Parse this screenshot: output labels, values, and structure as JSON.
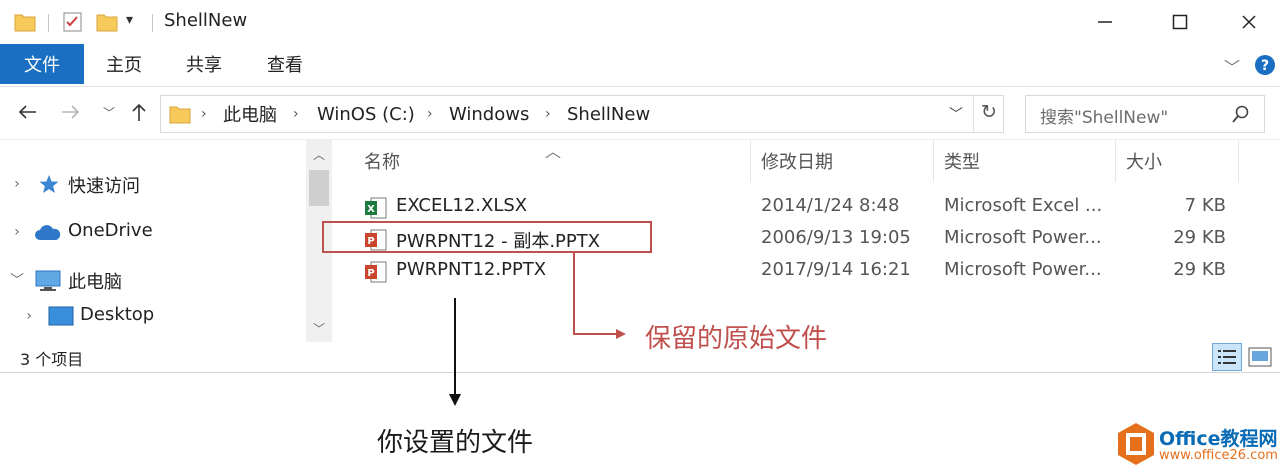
{
  "window": {
    "title": "ShellNew",
    "minimize_icon": "minimize-icon",
    "maximize_icon": "maximize-icon",
    "close_icon": "close-icon"
  },
  "ribbon": {
    "tabs": [
      "文件",
      "主页",
      "共享",
      "查看"
    ],
    "accent": "#1a6fc2"
  },
  "address": {
    "crumbs": [
      "此电脑",
      "WinOS (C:)",
      "Windows",
      "ShellNew"
    ],
    "search_placeholder": "搜索\"ShellNew\""
  },
  "nav": {
    "items": [
      {
        "label": "快速访问",
        "icon": "star-icon"
      },
      {
        "label": "OneDrive",
        "icon": "cloud-icon"
      },
      {
        "label": "此电脑",
        "icon": "computer-icon"
      },
      {
        "label": "Desktop",
        "icon": "desktop-icon"
      }
    ]
  },
  "list": {
    "columns": [
      "名称",
      "修改日期",
      "类型",
      "大小"
    ],
    "rows": [
      {
        "name": "EXCEL12.XLSX",
        "date": "2014/1/24 8:48",
        "type": "Microsoft Excel ...",
        "size": "7 KB",
        "icon": "excel-file-icon"
      },
      {
        "name": "PWRPNT12 - 副本.PPTX",
        "date": "2006/9/13 19:05",
        "type": "Microsoft Power...",
        "size": "29 KB",
        "icon": "powerpoint-file-icon"
      },
      {
        "name": "PWRPNT12.PPTX",
        "date": "2017/9/14 16:21",
        "type": "Microsoft Power...",
        "size": "29 KB",
        "icon": "powerpoint-file-icon"
      }
    ]
  },
  "status": {
    "count": "3 个项目"
  },
  "annotations": {
    "original_file": "保留的原始文件",
    "your_file": "你设置的文件",
    "highlight_color": "#c0504d"
  },
  "logo": {
    "title": "Office教程网",
    "url": "www.office26.com"
  }
}
